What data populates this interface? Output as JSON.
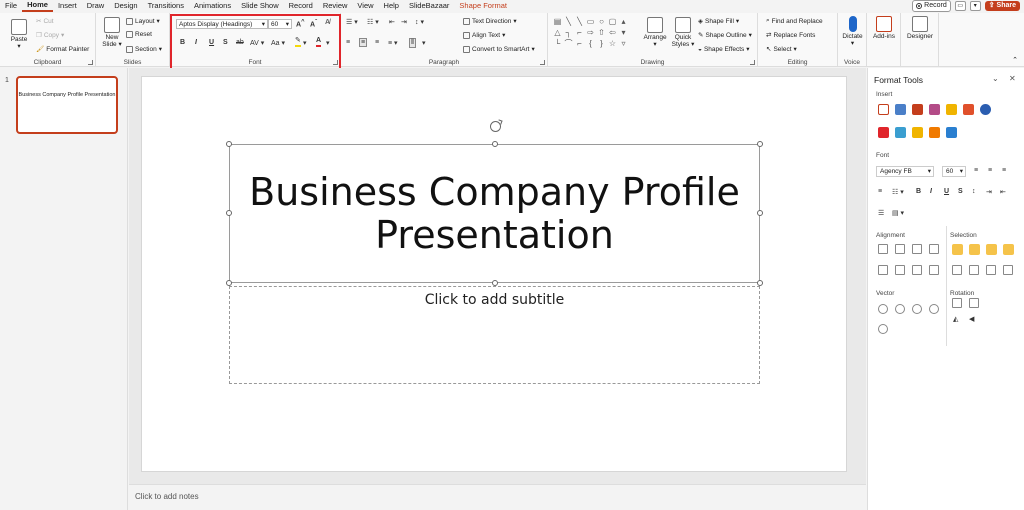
{
  "menu": {
    "tabs": [
      "File",
      "Home",
      "Insert",
      "Draw",
      "Design",
      "Transitions",
      "Animations",
      "Slide Show",
      "Record",
      "Review",
      "View",
      "Help",
      "SlideBazaar"
    ],
    "context_tab": "Shape Format",
    "record_label": "Record",
    "share_label": "Share"
  },
  "ribbon": {
    "clipboard": {
      "name": "Clipboard",
      "paste": "Paste",
      "cut": "Cut",
      "copy": "Copy",
      "format_painter": "Format Painter"
    },
    "slides": {
      "name": "Slides",
      "new_slide": "New Slide",
      "layout": "Layout",
      "reset": "Reset",
      "section": "Section"
    },
    "font": {
      "name": "Font",
      "font_family": "Aptos Display (Headings)",
      "font_size": "60",
      "bold": "B",
      "italic": "I",
      "underline": "U",
      "strike": "S",
      "spacing": "AV",
      "case": "Aa",
      "highlight_color": "#f5d90a",
      "font_color": "#e0252b"
    },
    "paragraph": {
      "name": "Paragraph",
      "text_direction": "Text Direction",
      "align_text": "Align Text",
      "convert_smartart": "Convert to SmartArt"
    },
    "drawing": {
      "name": "Drawing",
      "arrange": "Arrange",
      "quick_styles": "Quick Styles",
      "shape_fill": "Shape Fill",
      "shape_outline": "Shape Outline",
      "shape_effects": "Shape Effects"
    },
    "editing": {
      "name": "Editing",
      "find_replace": "Find and Replace",
      "replace_fonts": "Replace Fonts",
      "select": "Select"
    },
    "voice": {
      "name": "Voice",
      "dictate": "Dictate"
    },
    "addins": {
      "label": "Add-ins"
    },
    "designer": {
      "label": "Designer"
    }
  },
  "thumbnails": [
    {
      "number": "1",
      "title": "Business Company Profile Presentation"
    }
  ],
  "slide": {
    "title_line1": "Business Company Profile",
    "title_line2": "Presentation",
    "subtitle_placeholder": "Click to add subtitle"
  },
  "notes_placeholder": "Click to add notes",
  "format_tools": {
    "title": "Format Tools",
    "insert_label": "Insert",
    "font_label": "Font",
    "font_family": "Agency FB",
    "font_size": "60",
    "alignment_label": "Alignment",
    "selection_label": "Selection",
    "vector_label": "Vector",
    "rotation_label": "Rotation"
  },
  "colors": {
    "accent": "#c43e1c",
    "highlight_box": "#e0252b"
  }
}
